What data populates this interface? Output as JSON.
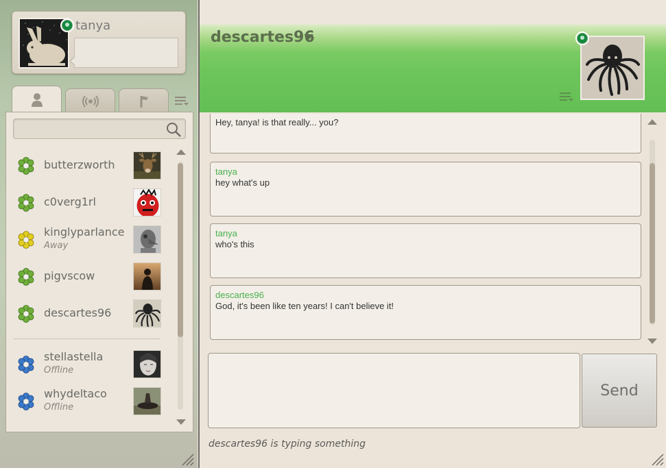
{
  "profile": {
    "name": "tanya",
    "status_message": "",
    "presence": "online"
  },
  "tabs": [
    {
      "icon": "person-icon",
      "active": true
    },
    {
      "icon": "broadcast-icon",
      "active": false
    },
    {
      "icon": "flag-icon",
      "active": false
    }
  ],
  "search": {
    "placeholder": "",
    "value": ""
  },
  "contacts": [
    {
      "name": "butterzworth",
      "status": "",
      "flower_color": "#6fae3a"
    },
    {
      "name": "c0verg1rl",
      "status": "",
      "flower_color": "#6fae3a"
    },
    {
      "name": "kinglyparlance",
      "status": "Away",
      "flower_color": "#e1cd1f"
    },
    {
      "name": "pigvscow",
      "status": "",
      "flower_color": "#6fae3a"
    },
    {
      "name": "descartes96",
      "status": "",
      "flower_color": "#6fae3a"
    }
  ],
  "offline_contacts": [
    {
      "name": "stellastella",
      "status": "Offline",
      "flower_color": "#3a78c9"
    },
    {
      "name": "whydeltaco",
      "status": "Offline",
      "flower_color": "#3a78c9"
    }
  ],
  "chat": {
    "peer_name": "descartes96",
    "peer_presence": "online",
    "messages": [
      {
        "sender": "",
        "text": "Hey, tanya! is that really... you?"
      },
      {
        "sender": "tanya",
        "text": "hey what's up"
      },
      {
        "sender": "tanya",
        "text": "who's this"
      },
      {
        "sender": "descartes96",
        "text": "God, it's been like ten years! I can't believe it!"
      }
    ],
    "compose_value": "",
    "send_label": "Send",
    "typing_status": "descartes96 is typing something"
  },
  "colors": {
    "accent_green": "#6cc55a",
    "sender_green": "#48b04d",
    "presence_online": "#128a3e"
  }
}
